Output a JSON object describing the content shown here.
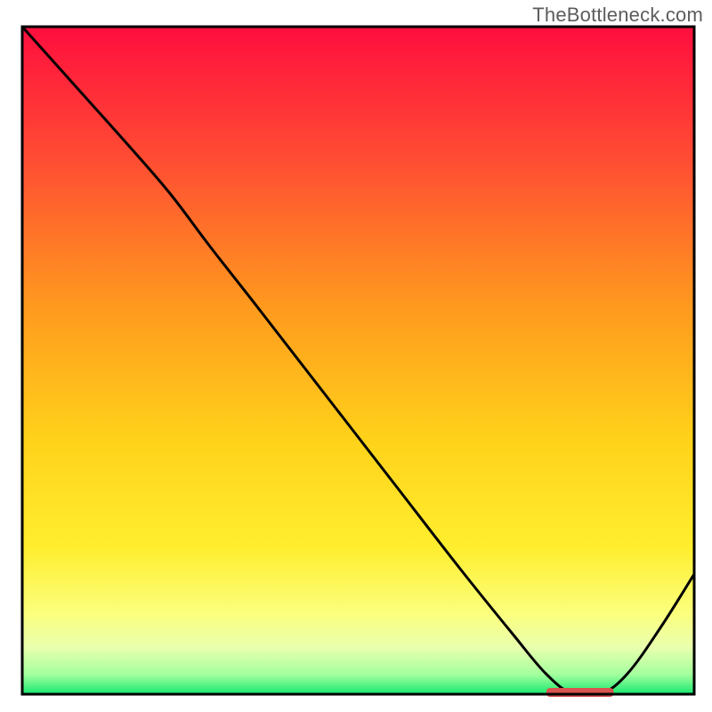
{
  "attribution": "TheBottleneck.com",
  "colors": {
    "outline": "#000000",
    "curve": "#000000",
    "marker": "#d9534f",
    "gradient_stops": [
      {
        "offset": 0.0,
        "color": "#ff0e3e"
      },
      {
        "offset": 0.2,
        "color": "#ff4d33"
      },
      {
        "offset": 0.42,
        "color": "#ff9a1e"
      },
      {
        "offset": 0.62,
        "color": "#ffd21a"
      },
      {
        "offset": 0.78,
        "color": "#ffee2e"
      },
      {
        "offset": 0.88,
        "color": "#fbff7e"
      },
      {
        "offset": 0.93,
        "color": "#e9ffae"
      },
      {
        "offset": 0.97,
        "color": "#a5ff9e"
      },
      {
        "offset": 1.0,
        "color": "#16e86f"
      }
    ]
  },
  "plot": {
    "view_w": 800,
    "view_h": 800,
    "inner_x": 25,
    "inner_y": 30,
    "inner_w": 755,
    "inner_h": 750,
    "outline_w": 3,
    "curve_w": 3
  },
  "chart_data": {
    "type": "line",
    "title": "",
    "xlabel": "",
    "ylabel": "",
    "xlim": [
      0,
      100
    ],
    "ylim": [
      0,
      100
    ],
    "comment": "x is position along horizontal axis (0=left,100=right); y is bottleneck % (0=bottom green optimum,100=top red). Curve drops from top-left, reaches ~0 near x≈80, rises toward right.",
    "series": [
      {
        "name": "bottleneck-curve",
        "x": [
          0,
          8,
          16,
          22,
          28,
          35,
          45,
          55,
          65,
          73,
          78,
          82,
          86,
          90,
          95,
          100
        ],
        "y": [
          100,
          91,
          82,
          75,
          67,
          58,
          45,
          32,
          19,
          9,
          3,
          0,
          0,
          3,
          10,
          18
        ]
      }
    ],
    "marker": {
      "x_start": 78,
      "x_end": 88,
      "y": 0
    }
  }
}
